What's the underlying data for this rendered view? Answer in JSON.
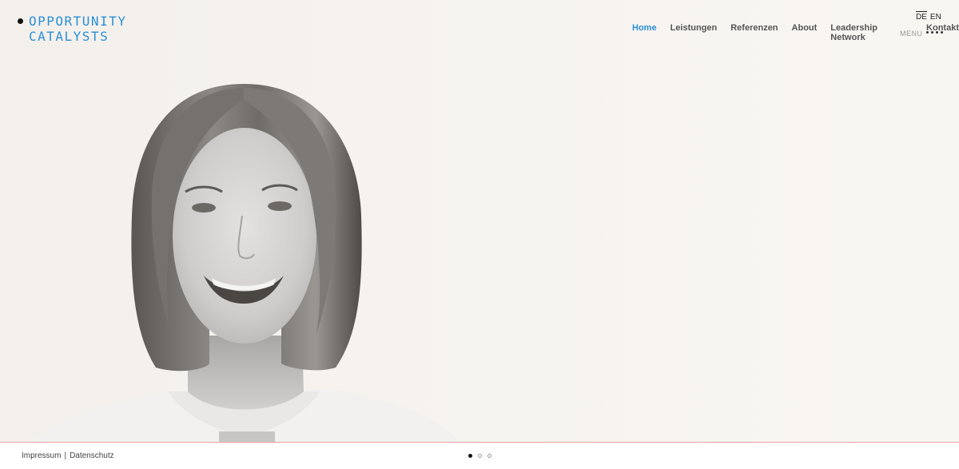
{
  "logo": {
    "line1": "OPPORTUNITY",
    "line2": "CATALYSTS"
  },
  "lang": {
    "options": [
      "DE",
      "EN"
    ],
    "active": "DE"
  },
  "nav": {
    "items": [
      {
        "label": "Home",
        "active": true
      },
      {
        "label": "Leistungen"
      },
      {
        "label": "Referenzen"
      },
      {
        "label": "About"
      },
      {
        "label": "Leadership Network"
      },
      {
        "label": "Kontakt"
      }
    ],
    "menu_label": "MENU"
  },
  "footer": {
    "impressum": "Impressum",
    "separator": "|",
    "datenschutz": "Datenschutz"
  },
  "slider": {
    "slides": 3,
    "active": 0
  },
  "colors": {
    "accent": "#2b8fd6",
    "background": "#f6f3ef",
    "footer_border": "#e9a49a"
  },
  "icons": {
    "menu": "dots-menu-icon",
    "logo_mark": "dot-icon"
  }
}
